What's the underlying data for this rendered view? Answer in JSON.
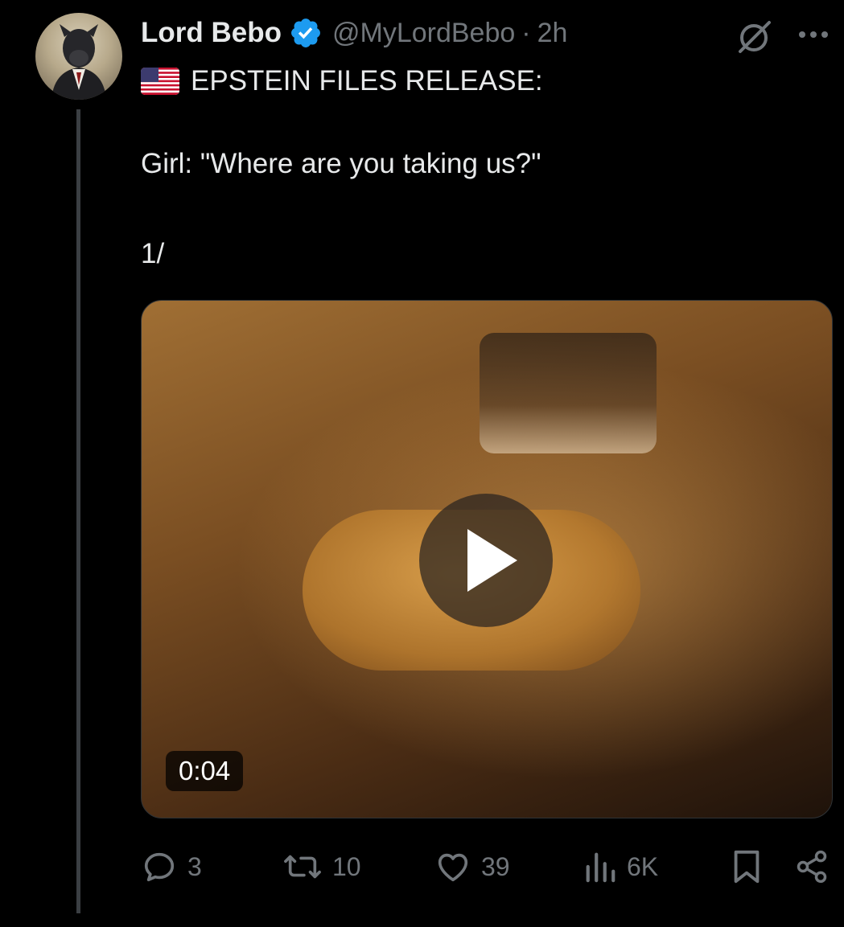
{
  "post": {
    "author": {
      "display_name": "Lord Bebo",
      "handle": "@MyLordBebo",
      "separator": "·",
      "time": "2h",
      "verified": true
    },
    "text": {
      "line1": "EPSTEIN FILES RELEASE:",
      "line2": "Girl: \"Where are you taking us?\"",
      "line3": "1/"
    },
    "flag_emoji": "us-flag-icon",
    "media": {
      "type": "video",
      "duration": "0:04"
    },
    "actions": {
      "replies": "3",
      "reposts": "10",
      "likes": "39",
      "views": "6K"
    }
  },
  "colors": {
    "background": "#000000",
    "text_primary": "#e7e9ea",
    "text_secondary": "#71767b",
    "verified_blue": "#1d9bf0",
    "thread_line": "#3b3f43"
  }
}
